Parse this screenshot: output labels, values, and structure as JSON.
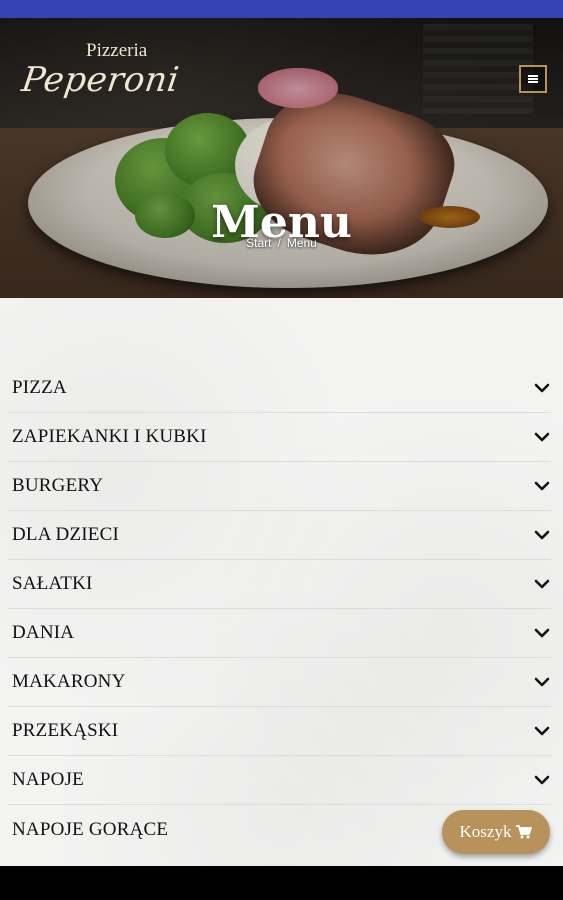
{
  "header": {
    "logo_line1": "Pizzeria",
    "logo_line2": "Peperoni",
    "menu_icon": "hamburger-icon",
    "title": "Menu",
    "breadcrumb": [
      {
        "label": "Start"
      },
      {
        "label": "Menu"
      }
    ],
    "breadcrumb_separator": "/"
  },
  "menu": {
    "chevron_icon": "chevron-down-icon",
    "categories": [
      {
        "label": "PIZZA"
      },
      {
        "label": "ZAPIEKANKI I KUBKI"
      },
      {
        "label": "BURGERY"
      },
      {
        "label": "DLA DZIECI"
      },
      {
        "label": "SAŁATKI"
      },
      {
        "label": "DANIA"
      },
      {
        "label": "MAKARONY"
      },
      {
        "label": "PRZEKĄSKI"
      },
      {
        "label": "NAPOJE"
      },
      {
        "label": "NAPOJE GORĄCE"
      }
    ]
  },
  "cart": {
    "label": "Koszyk",
    "icon": "cart-icon"
  },
  "colors": {
    "status_bar": "#3443b4",
    "accent_gold": "#b7925a",
    "content_bg": "#f3f3f2",
    "text": "#111111"
  }
}
